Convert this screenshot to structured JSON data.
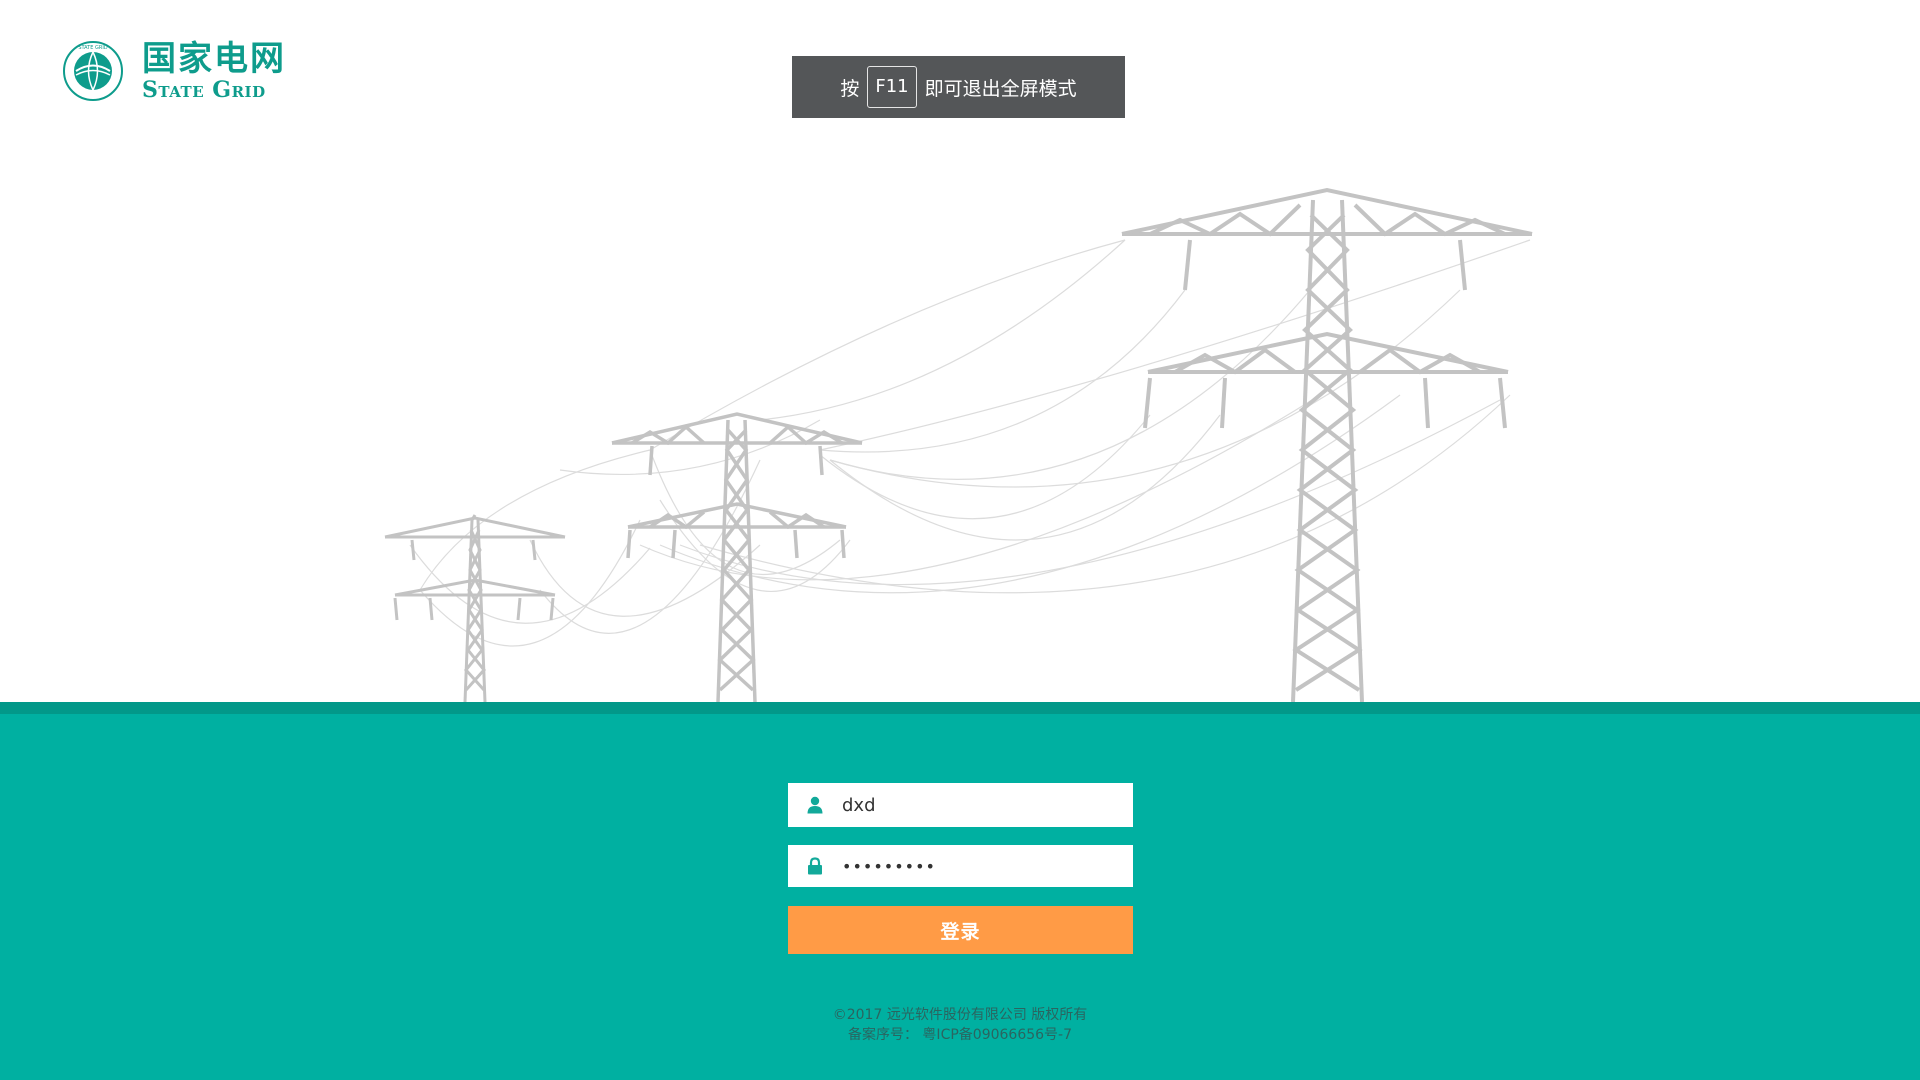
{
  "logo": {
    "name_cn": "国家电网",
    "name_en": "State Grid",
    "emblem_text": "STATE GRID CORPORATION OF CHINA"
  },
  "fullscreen_notice": {
    "prefix": "按",
    "key": "F11",
    "suffix": "即可退出全屏模式"
  },
  "login": {
    "username_value": "dxd",
    "password_value": "•••••••••",
    "submit_label": "登录"
  },
  "footer": {
    "copyright": "©2017 远光软件股份有限公司 版权所有",
    "icp": "备案序号： 粤ICP备09066656号-7"
  },
  "colors": {
    "brand_teal": "#00b0a1",
    "ground_stripe": "#029889",
    "button_orange": "#ff9b46",
    "notice_bg": "#545658",
    "logo_green": "#0e9c8c"
  },
  "icons": {
    "user": "user-icon",
    "lock": "lock-icon",
    "logo": "state-grid-emblem-icon"
  }
}
